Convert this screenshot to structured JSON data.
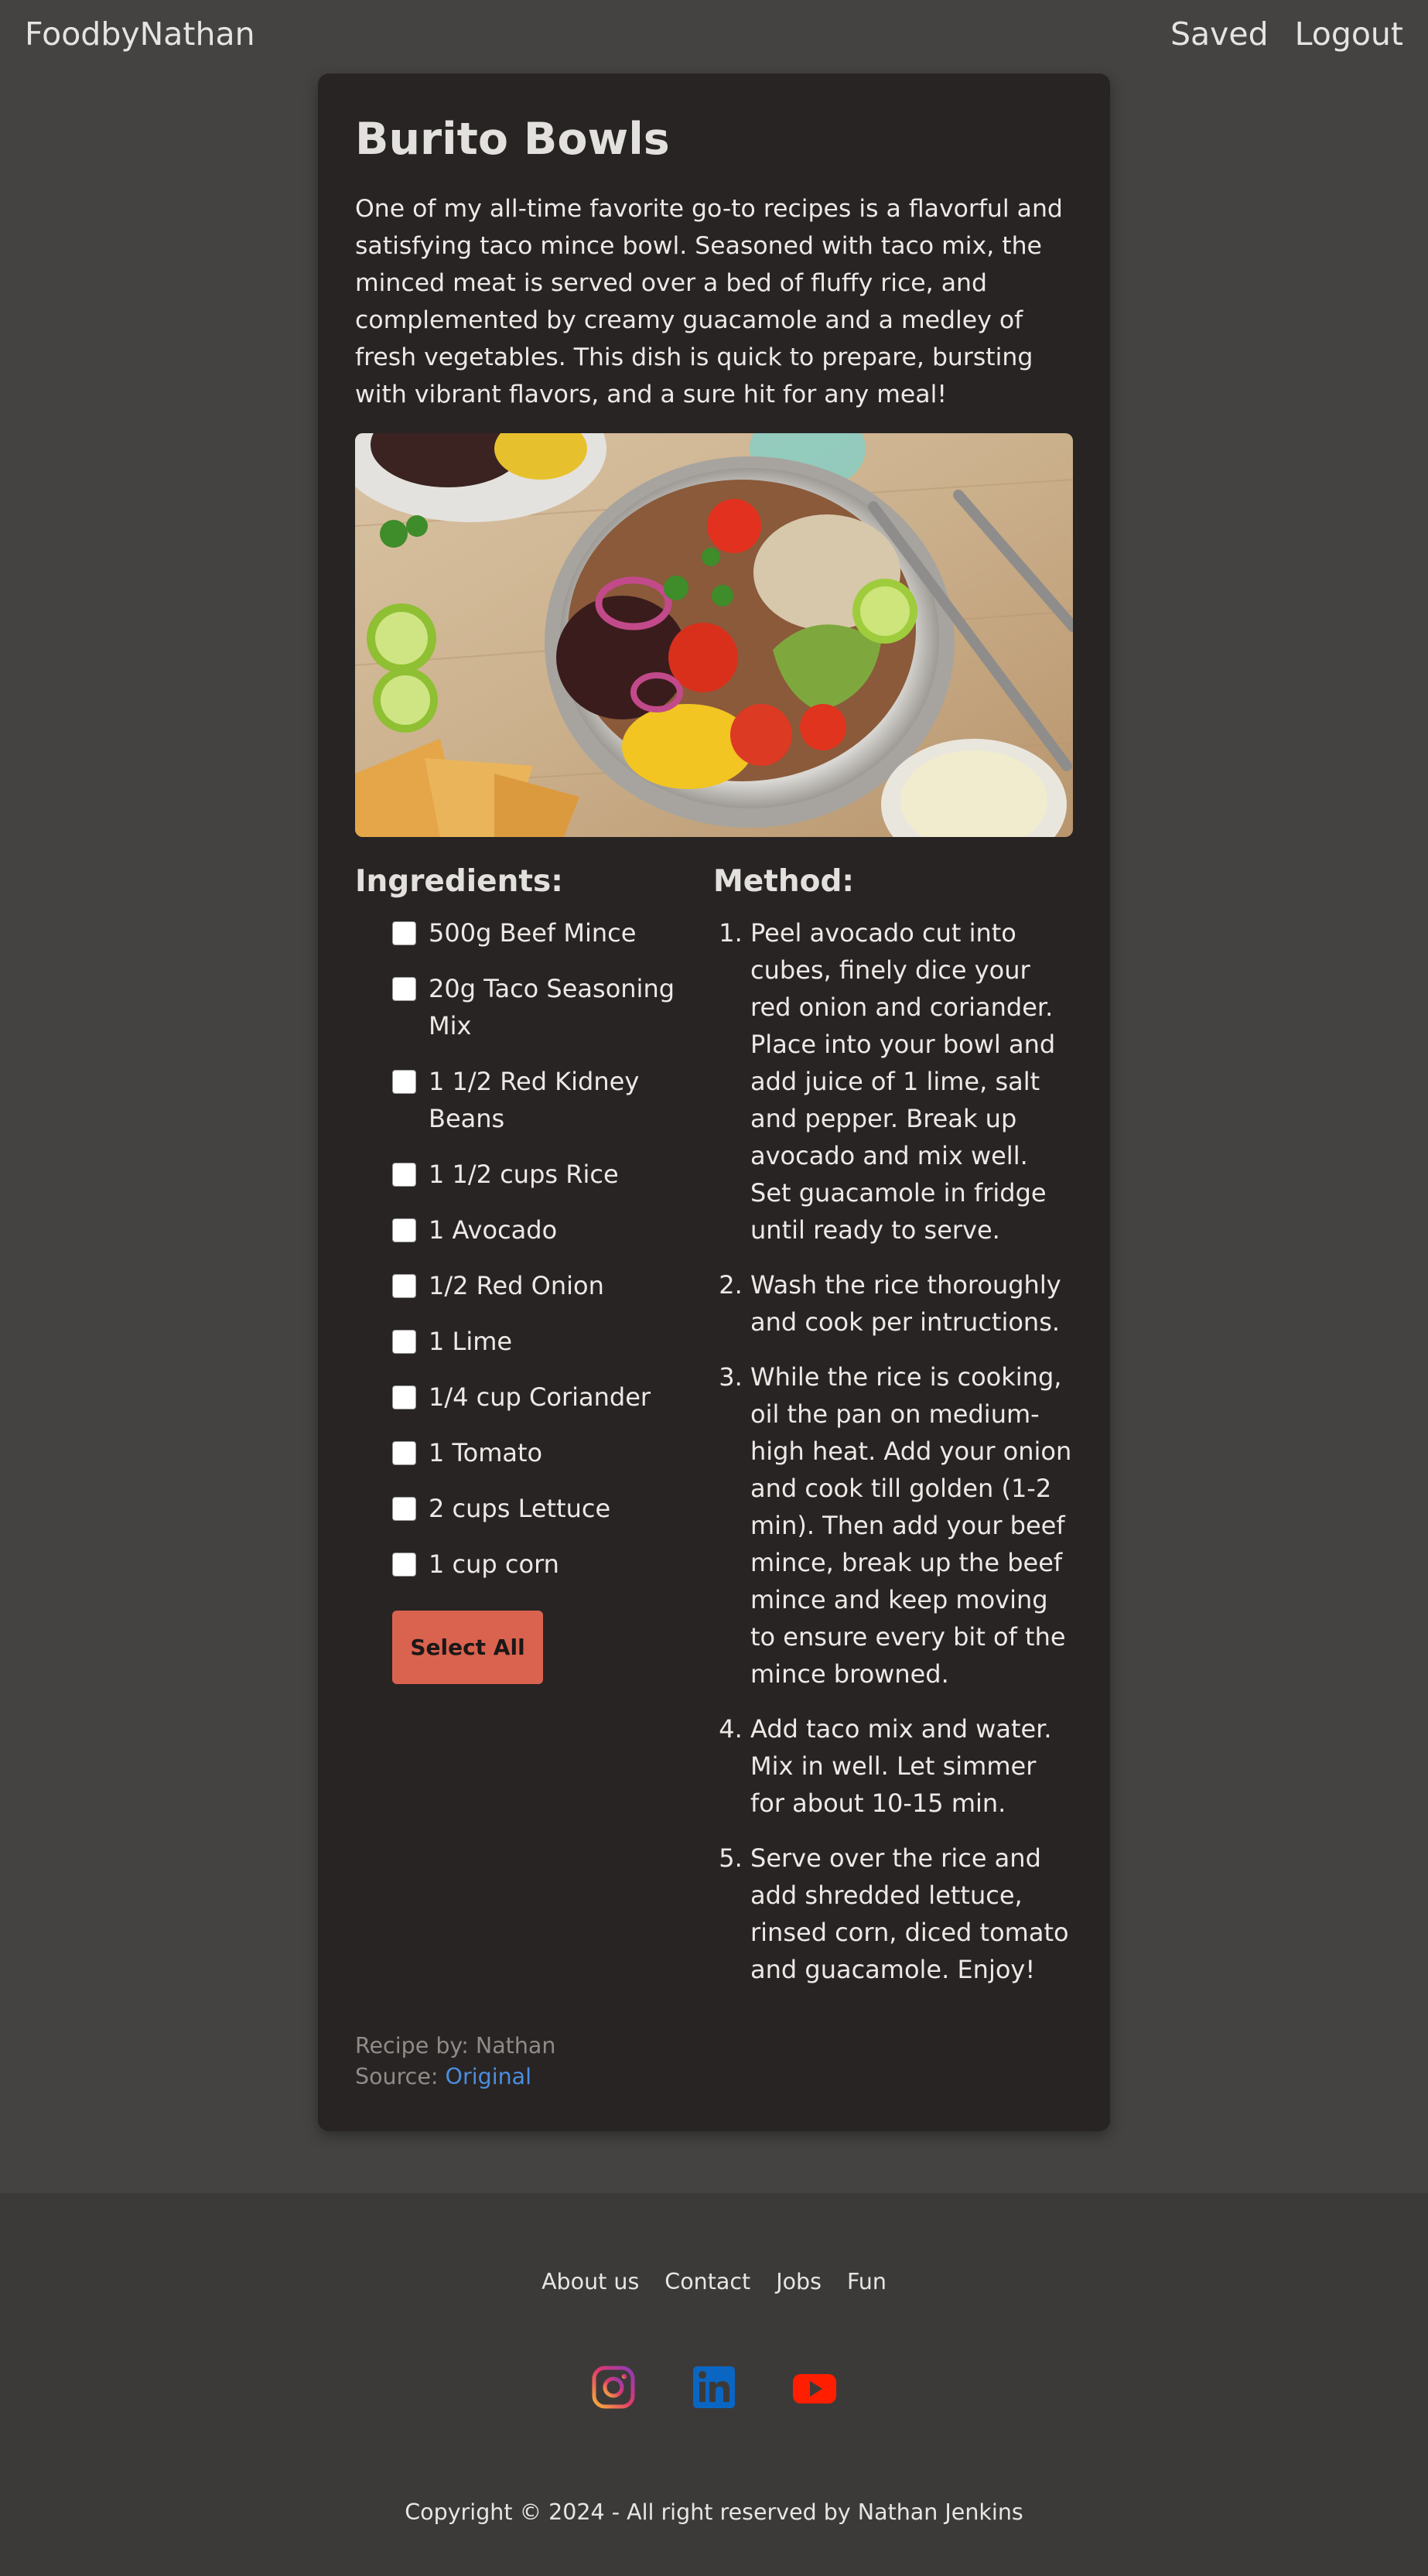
{
  "nav": {
    "brand": "FoodbyNathan",
    "saved": "Saved",
    "logout": "Logout"
  },
  "recipe": {
    "title": "Burito Bowls",
    "description": "One of my all-time favorite go-to recipes is a flavorful and satisfying taco mince bowl. Seasoned with taco mix, the minced meat is served over a bed of fluffy rice, and complemented by creamy guacamole and a medley of fresh vegetables. This dish is quick to prepare, bursting with vibrant flavors, and a sure hit for any meal!",
    "ingredients_heading": "Ingredients:",
    "method_heading": "Method:",
    "ingredients": [
      "500g Beef Mince",
      "20g Taco Seasoning Mix",
      "1 1/2 Red Kidney Beans",
      "1 1/2 cups Rice",
      "1 Avocado",
      "1/2 Red Onion",
      "1 Lime",
      "1/4 cup Coriander",
      "1 Tomato",
      "2 cups Lettuce",
      "1 cup corn"
    ],
    "select_all": "Select All",
    "method": [
      "Peel avocado cut into cubes, finely dice your red onion and coriander. Place into your bowl and add juice of 1 lime, salt and pepper. Break up avocado and mix well. Set guacamole in fridge until ready to serve.",
      "Wash the rice thoroughly and cook per intructions.",
      "While the rice is cooking, oil the pan on medium-high heat. Add your onion and cook till golden (1-2 min). Then add your beef mince, break up the beef mince and keep moving to ensure every bit of the mince browned.",
      "Add taco mix and water. Mix in well. Let simmer for about 10-15 min.",
      "Serve over the rice and add shredded lettuce, rinsed corn, diced tomato and guacamole. Enjoy!"
    ],
    "recipe_by_label": "Recipe by: Nathan",
    "source_label": "Source: ",
    "source_link": "Original"
  },
  "footer": {
    "links": [
      "About us",
      "Contact",
      "Jobs",
      "Fun"
    ],
    "socials": [
      "instagram-icon",
      "linkedin-icon",
      "youtube-icon"
    ],
    "copyright": "Copyright © 2024 - All right reserved by Nathan Jenkins"
  },
  "colors": {
    "page_bg": "#454342",
    "card_bg": "#282423",
    "button": "#d9634f",
    "link": "#4c8dde",
    "footer_bg": "#3c3a39"
  }
}
